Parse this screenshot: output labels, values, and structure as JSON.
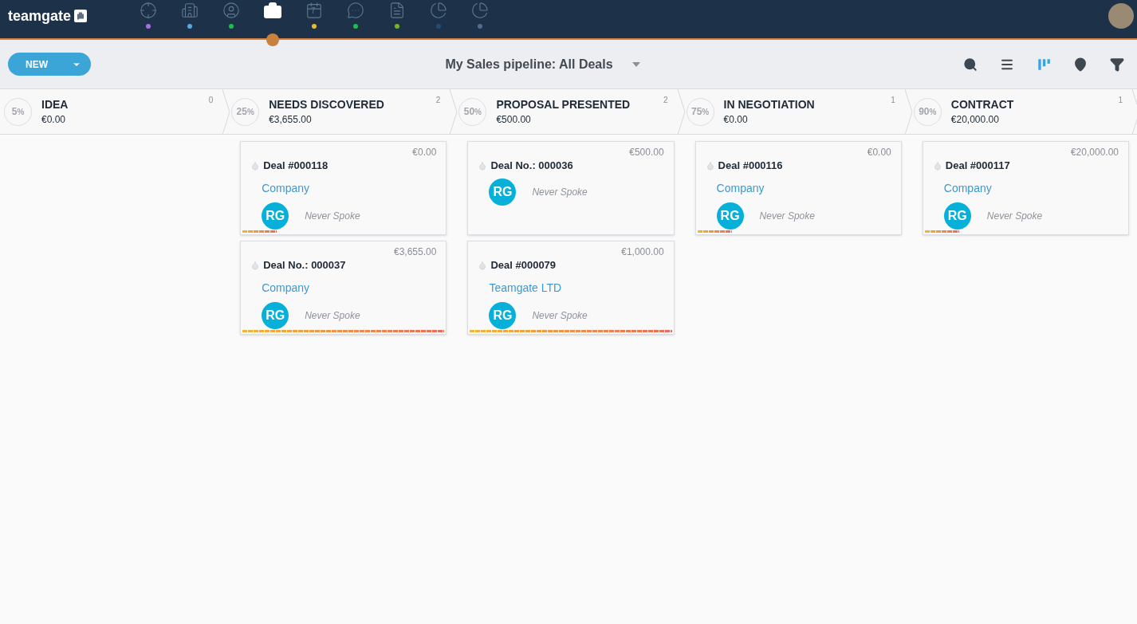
{
  "brand": {
    "name": "teamgate"
  },
  "nav": [
    {
      "kind": "target",
      "selected": false,
      "color": "#a66ee8"
    },
    {
      "kind": "buildings",
      "selected": false,
      "color": "#5aa9de"
    },
    {
      "kind": "person",
      "selected": false,
      "color": "#1dbf4a"
    },
    {
      "kind": "briefcase",
      "selected": true
    },
    {
      "kind": "calendar",
      "selected": false,
      "color": "#e5c02c",
      "badge": "7"
    },
    {
      "kind": "chat",
      "selected": false,
      "color": "#1dbf4a"
    },
    {
      "kind": "document",
      "selected": false,
      "color": "#79b51f"
    },
    {
      "kind": "pie",
      "selected": false,
      "color": "#1c4f7c"
    },
    {
      "kind": "pie",
      "selected": false,
      "color": "#4f6f92"
    }
  ],
  "toolbar": {
    "new_button": "NEW",
    "title": "My Sales pipeline: All Deals",
    "views": [
      {
        "kind": "search",
        "selected": false
      },
      {
        "kind": "list",
        "selected": false
      },
      {
        "kind": "kanban",
        "selected": true
      },
      {
        "kind": "pin",
        "selected": false
      },
      {
        "kind": "filter",
        "selected": false
      }
    ]
  },
  "stages": [
    {
      "percent": "5",
      "unit": "%",
      "name": "IDEA",
      "amount": "€0.00",
      "count": "0"
    },
    {
      "percent": "25",
      "unit": "%",
      "name": "NEEDS DISCOVERED",
      "amount": "€3,655.00",
      "count": "2",
      "deals": [
        {
          "value": "€0.00",
          "title": "Deal #000118",
          "company": "Company",
          "owner": "RG",
          "status": "Never Spoke",
          "level": 0.17
        },
        {
          "value": "€3,655.00",
          "title": "Deal No.: 000037",
          "company": "Company",
          "owner": "RG",
          "status": "Never Spoke",
          "level": 1
        }
      ]
    },
    {
      "percent": "50",
      "unit": "%",
      "name": "PROPOSAL PRESENTED",
      "amount": "€500.00",
      "count": "2",
      "deals": [
        {
          "value": "€500.00",
          "title": "Deal No.: 000036",
          "owner": "RG",
          "status": "Never Spoke"
        },
        {
          "value": "€1,000.00",
          "title": "Deal #000079",
          "company": "Teamgate LTD",
          "owner": "RG",
          "status": "Never Spoke",
          "level": 1
        }
      ]
    },
    {
      "percent": "75",
      "unit": "%",
      "name": "IN NEGOTIATION",
      "amount": "€0.00",
      "count": "1",
      "deals": [
        {
          "value": "€0.00",
          "title": "Deal #000116",
          "company": "Company",
          "owner": "RG",
          "status": "Never Spoke",
          "level": 0.17
        }
      ]
    },
    {
      "percent": "90",
      "unit": "%",
      "name": "CONTRACT",
      "amount": "€20,000.00",
      "count": "1",
      "deals": [
        {
          "value": "€20,000.00",
          "title": "Deal #000117",
          "company": "Company",
          "owner": "RG",
          "status": "Never Spoke",
          "level": 0.17
        }
      ]
    }
  ]
}
